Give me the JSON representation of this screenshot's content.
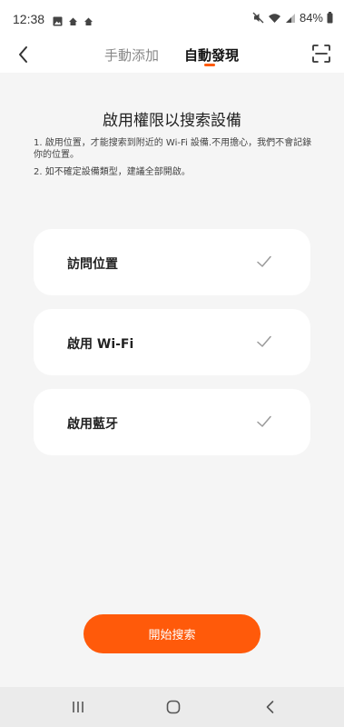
{
  "status_bar": {
    "time": "12:38",
    "battery_percent": "84%",
    "icons": [
      "gallery-icon",
      "app-notification-icon",
      "app-notification-icon",
      "mute-icon",
      "wifi-icon",
      "signal-icon",
      "battery-icon"
    ]
  },
  "header": {
    "tabs": [
      {
        "label": "手動添加",
        "active": false
      },
      {
        "label": "自動發現",
        "active": true
      }
    ],
    "left_icon": "back-chevron-icon",
    "right_icon": "scan-icon",
    "accent_color": "#ff5a00"
  },
  "main": {
    "title": "啟用權限以搜索設備",
    "tips": [
      "1. 啟用位置，才能搜索到附近的 Wi-Fi 設備.不用擔心，我們不會記錄你的位置。",
      "2. 如不確定設備類型，建議全部開啟。"
    ],
    "permissions": [
      {
        "label": "訪問位置",
        "checked": true
      },
      {
        "label": "啟用 Wi-Fi",
        "checked": true
      },
      {
        "label": "啟用藍牙",
        "checked": true
      }
    ],
    "start_button": "開始搜索"
  },
  "nav_bar": {
    "icons": [
      "recent-apps-icon",
      "home-icon",
      "back-icon"
    ]
  }
}
